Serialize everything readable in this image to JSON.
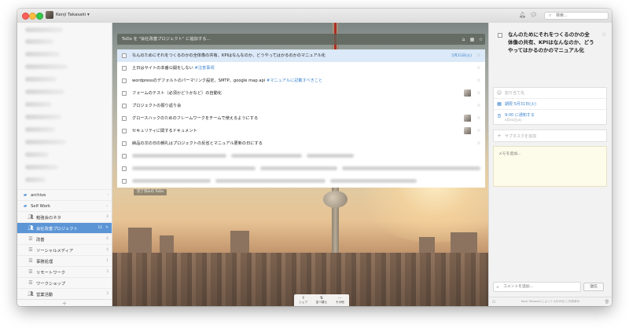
{
  "window": {
    "user_name": "Kenji Takasaki ▾",
    "search_placeholder": "検索..."
  },
  "sidebar": {
    "folders": [
      {
        "label": "archive",
        "count": ""
      },
      {
        "label": "Self Work",
        "count": ""
      }
    ],
    "lists": [
      {
        "label": "勉強会のネタ",
        "count": "4",
        "active": false
      },
      {
        "label": "会社改善プロジェクト",
        "count": "11",
        "active": true
      },
      {
        "label": "改善",
        "count": "6",
        "active": false
      },
      {
        "label": "ソーシャルメディア",
        "count": "4",
        "active": false
      },
      {
        "label": "事務処理",
        "count": "1",
        "active": false
      },
      {
        "label": "リモートワーク",
        "count": "3",
        "active": false
      },
      {
        "label": "ワークショップ",
        "count": "",
        "active": false
      },
      {
        "label": "営業活動",
        "count": "3",
        "active": false
      }
    ],
    "add_label": "+"
  },
  "main": {
    "add_placeholder": "ToDo を \"会社改善プロジェクト\" に追加する...",
    "tasks": [
      {
        "title": "なんのためにそれをつくるのかの全体像の共有、KPIはなんなのか、どうやってはかるのかのマニュアル化",
        "tag": "",
        "due": "5月31日(火)",
        "assigned": false,
        "selected": true
      },
      {
        "title": "土日はサイトの本番公開をしない ",
        "tag": "#注意事項",
        "due": "",
        "assigned": false,
        "selected": false
      },
      {
        "title": "wordpressのデフォルトのパーマリンク設定、SMTP、google map api ",
        "tag": "#マニュアルに記載すべきこと",
        "due": "",
        "assigned": false,
        "selected": false
      },
      {
        "title": "フォームのテスト（必須かどうかなど）の自動化",
        "tag": "",
        "due": "",
        "assigned": true,
        "selected": false
      },
      {
        "title": "プロジェクトの振り返り会",
        "tag": "",
        "due": "",
        "assigned": false,
        "selected": false
      },
      {
        "title": "グロースハックのためのフレームワークをチームで使えるようにする",
        "tag": "",
        "due": "",
        "assigned": true,
        "selected": false
      },
      {
        "title": "セキュリティに関するドキュメント",
        "tag": "",
        "due": "",
        "assigned": true,
        "selected": false
      },
      {
        "title": "納品の次の日の朝礼はプロジェクトの反省とマニュアル更新の日にする",
        "tag": "",
        "due": "",
        "assigned": false,
        "selected": false
      }
    ],
    "completed_label": "完了済みの ToDo",
    "toolbar": {
      "share": "シェア",
      "sort": "並べ替え",
      "more": "その他"
    }
  },
  "detail": {
    "title": "なんのためにそれをつくるのかの全体像の共有、KPIはなんなのか、どうやってはかるのかのマニュアル化",
    "assign_placeholder": "割り当て先",
    "due_label": "期限 5月31日(火)",
    "reminder_label": "9:00 に通知する",
    "reminder_sub": "5月31日(火)",
    "subtask_placeholder": "サブタスクを追加",
    "note_placeholder": "メモを追加...",
    "comment_placeholder": "コメントを追加...",
    "send_label": "送信",
    "footer_text": "Kenji Takasaki によって 4月18日 に作成済み"
  },
  "colors": {
    "accent": "#5b95d6",
    "due_blue": "#3f84cf"
  }
}
